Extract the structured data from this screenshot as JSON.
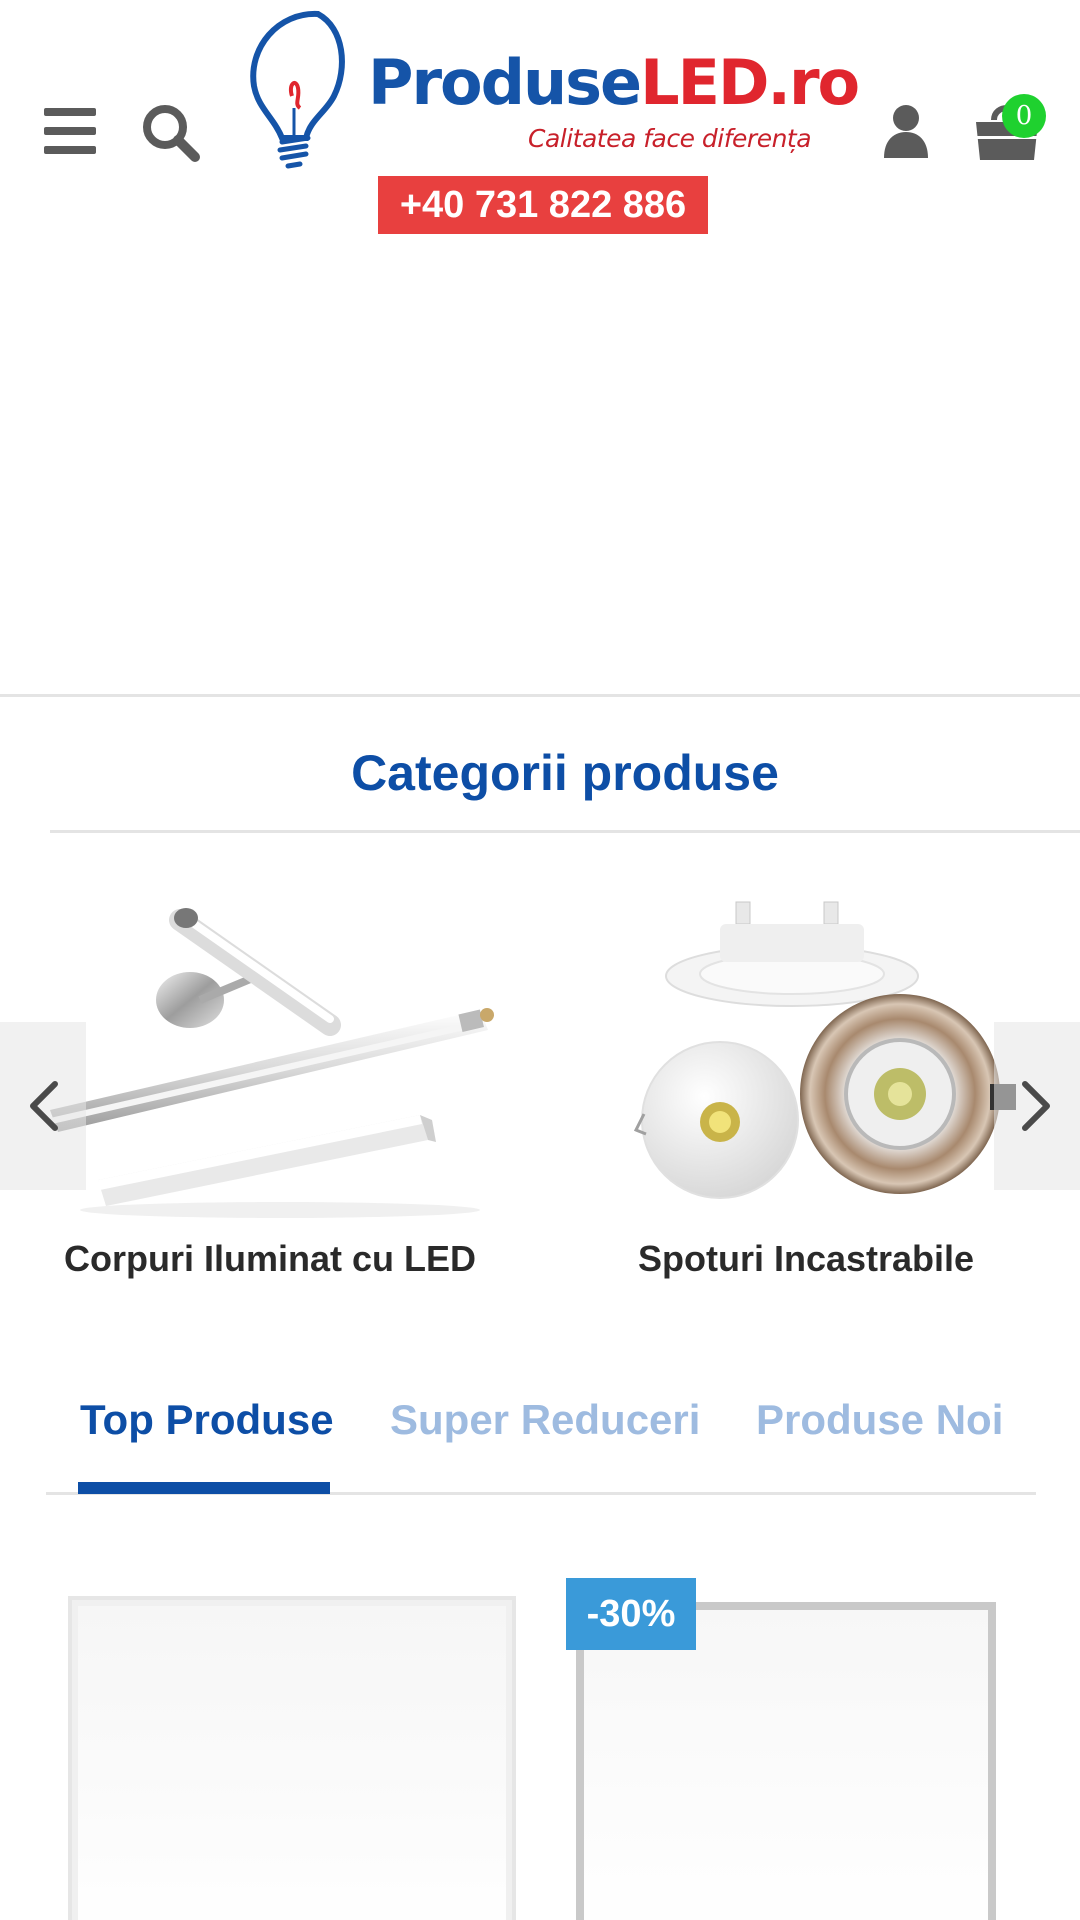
{
  "header": {
    "logo": {
      "name_part1": "Produse",
      "name_part2": "LED.ro",
      "tagline": "Calitatea face diferența"
    },
    "phone": "+40 731 822 886",
    "cart_count": "0",
    "icons": {
      "menu": "menu-icon",
      "search": "search-icon",
      "account": "user-icon",
      "cart": "cart-icon"
    }
  },
  "categories": {
    "title": "Categorii produse",
    "items": [
      {
        "label": "Corpuri Iluminat cu LED",
        "icon": "led-fixtures-image"
      },
      {
        "label": "Spoturi Incastrabile",
        "icon": "recessed-spotlights-image"
      }
    ]
  },
  "tabs": [
    {
      "label": "Top Produse",
      "active": true
    },
    {
      "label": "Super Reduceri",
      "active": false
    },
    {
      "label": "Produse Noi",
      "active": false
    }
  ],
  "products": [
    {
      "badge": ""
    },
    {
      "badge": "-30%"
    }
  ],
  "colors": {
    "brand_blue": "#0d4ea6",
    "brand_red": "#e8403f",
    "tab_inactive": "#9ebbe0",
    "badge_blue": "#3a9ad9",
    "cart_badge_green": "#1fd12f"
  }
}
